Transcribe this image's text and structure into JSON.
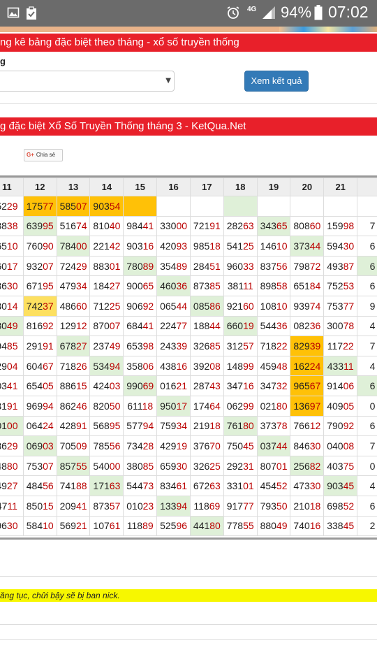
{
  "status_bar": {
    "network": "4G",
    "battery_pct": "94%",
    "time": "07:02",
    "icons": [
      "image-icon",
      "clipboard-icon",
      "alarm-icon",
      "signal-icon",
      "battery-icon"
    ]
  },
  "header_title": "ng kê bảng đặc biệt theo tháng - xổ số truyền thống",
  "form": {
    "label": "g",
    "select_value": "",
    "submit_label": "Xem kết quả"
  },
  "result_title": "g đặc biệt Xổ Số Truyền Thống tháng 3 - KetQua.Net",
  "share_label": "Chia sẻ",
  "table": {
    "columns": [
      "11",
      "12",
      "13",
      "14",
      "15",
      "16",
      "17",
      "18",
      "19",
      "20",
      "21",
      ""
    ],
    "rows": [
      [
        [
          "5229",
          ""
        ],
        [
          "17577",
          "o"
        ],
        [
          "58507",
          "o"
        ],
        [
          "90354",
          "o"
        ],
        [
          "",
          "o"
        ],
        [
          "",
          ""
        ],
        [
          "",
          ""
        ],
        [
          "",
          "g"
        ],
        [
          "",
          ""
        ],
        [
          "",
          ""
        ],
        [
          "",
          ""
        ],
        [
          "",
          ""
        ]
      ],
      [
        [
          "3838",
          ""
        ],
        [
          "63995",
          "g"
        ],
        [
          "51674",
          ""
        ],
        [
          "81040",
          ""
        ],
        [
          "98441",
          ""
        ],
        [
          "33000",
          ""
        ],
        [
          "72191",
          ""
        ],
        [
          "28263",
          ""
        ],
        [
          "34365",
          "g"
        ],
        [
          "80860",
          ""
        ],
        [
          "15998",
          ""
        ],
        [
          "7",
          ""
        ]
      ],
      [
        [
          "6510",
          ""
        ],
        [
          "76090",
          ""
        ],
        [
          "78400",
          "g"
        ],
        [
          "22142",
          ""
        ],
        [
          "90316",
          ""
        ],
        [
          "42093",
          ""
        ],
        [
          "98518",
          ""
        ],
        [
          "54125",
          ""
        ],
        [
          "14610",
          ""
        ],
        [
          "37344",
          "g"
        ],
        [
          "59430",
          ""
        ],
        [
          "6",
          ""
        ]
      ],
      [
        [
          "6017",
          ""
        ],
        [
          "93207",
          ""
        ],
        [
          "72429",
          ""
        ],
        [
          "88301",
          ""
        ],
        [
          "78089",
          "g"
        ],
        [
          "35489",
          ""
        ],
        [
          "28451",
          ""
        ],
        [
          "96033",
          ""
        ],
        [
          "83756",
          ""
        ],
        [
          "79872",
          ""
        ],
        [
          "49387",
          ""
        ],
        [
          "6",
          "g"
        ]
      ],
      [
        [
          "3630",
          ""
        ],
        [
          "67195",
          ""
        ],
        [
          "47934",
          ""
        ],
        [
          "18427",
          ""
        ],
        [
          "90065",
          ""
        ],
        [
          "46036",
          "g"
        ],
        [
          "87385",
          ""
        ],
        [
          "38111",
          ""
        ],
        [
          "89858",
          ""
        ],
        [
          "65184",
          ""
        ],
        [
          "75253",
          ""
        ],
        [
          "6",
          ""
        ]
      ],
      [
        [
          "3014",
          ""
        ],
        [
          "74237",
          "y"
        ],
        [
          "48660",
          ""
        ],
        [
          "71225",
          ""
        ],
        [
          "90692",
          ""
        ],
        [
          "06544",
          ""
        ],
        [
          "08586",
          "g"
        ],
        [
          "92160",
          ""
        ],
        [
          "10810",
          ""
        ],
        [
          "93974",
          ""
        ],
        [
          "75377",
          ""
        ],
        [
          "9",
          ""
        ]
      ],
      [
        [
          "8049",
          "g"
        ],
        [
          "81692",
          ""
        ],
        [
          "12912",
          ""
        ],
        [
          "87007",
          ""
        ],
        [
          "68441",
          ""
        ],
        [
          "22477",
          ""
        ],
        [
          "18844",
          ""
        ],
        [
          "66019",
          "g"
        ],
        [
          "54436",
          ""
        ],
        [
          "08236",
          ""
        ],
        [
          "30078",
          ""
        ],
        [
          "4",
          ""
        ]
      ],
      [
        [
          "9485",
          ""
        ],
        [
          "29191",
          ""
        ],
        [
          "67827",
          "g"
        ],
        [
          "23749",
          ""
        ],
        [
          "65398",
          ""
        ],
        [
          "24339",
          ""
        ],
        [
          "32685",
          ""
        ],
        [
          "31257",
          ""
        ],
        [
          "71822",
          ""
        ],
        [
          "82939",
          "o"
        ],
        [
          "11722",
          ""
        ],
        [
          "7",
          ""
        ]
      ],
      [
        [
          "2904",
          ""
        ],
        [
          "60467",
          ""
        ],
        [
          "71826",
          ""
        ],
        [
          "53494",
          "g"
        ],
        [
          "35806",
          ""
        ],
        [
          "43816",
          ""
        ],
        [
          "39208",
          ""
        ],
        [
          "14899",
          ""
        ],
        [
          "45948",
          ""
        ],
        [
          "16224",
          "o"
        ],
        [
          "43311",
          "g"
        ],
        [
          "4",
          ""
        ]
      ],
      [
        [
          "0341",
          ""
        ],
        [
          "65405",
          ""
        ],
        [
          "88615",
          ""
        ],
        [
          "42403",
          ""
        ],
        [
          "99069",
          "g"
        ],
        [
          "01621",
          ""
        ],
        [
          "28743",
          ""
        ],
        [
          "34716",
          ""
        ],
        [
          "34732",
          ""
        ],
        [
          "96567",
          "o"
        ],
        [
          "91406",
          ""
        ],
        [
          "6",
          "g"
        ]
      ],
      [
        [
          "3191",
          ""
        ],
        [
          "96994",
          ""
        ],
        [
          "86246",
          ""
        ],
        [
          "82050",
          ""
        ],
        [
          "61118",
          ""
        ],
        [
          "95017",
          "g"
        ],
        [
          "17464",
          ""
        ],
        [
          "06299",
          ""
        ],
        [
          "02180",
          ""
        ],
        [
          "13697",
          "o"
        ],
        [
          "40905",
          ""
        ],
        [
          "0",
          ""
        ]
      ],
      [
        [
          "0100",
          "g"
        ],
        [
          "06424",
          ""
        ],
        [
          "42891",
          ""
        ],
        [
          "56895",
          ""
        ],
        [
          "57794",
          ""
        ],
        [
          "75934",
          ""
        ],
        [
          "21918",
          ""
        ],
        [
          "76180",
          "g"
        ],
        [
          "37378",
          ""
        ],
        [
          "76612",
          ""
        ],
        [
          "79092",
          ""
        ],
        [
          "6",
          ""
        ]
      ],
      [
        [
          "8629",
          ""
        ],
        [
          "06903",
          "g"
        ],
        [
          "70509",
          ""
        ],
        [
          "78556",
          ""
        ],
        [
          "73428",
          ""
        ],
        [
          "42919",
          ""
        ],
        [
          "37670",
          ""
        ],
        [
          "75045",
          ""
        ],
        [
          "03744",
          "g"
        ],
        [
          "84630",
          ""
        ],
        [
          "04008",
          ""
        ],
        [
          "7",
          ""
        ]
      ],
      [
        [
          "4880",
          ""
        ],
        [
          "75307",
          ""
        ],
        [
          "85755",
          "g"
        ],
        [
          "54000",
          ""
        ],
        [
          "38085",
          ""
        ],
        [
          "65930",
          ""
        ],
        [
          "32625",
          ""
        ],
        [
          "29231",
          ""
        ],
        [
          "80701",
          ""
        ],
        [
          "25682",
          "g"
        ],
        [
          "40375",
          ""
        ],
        [
          "0",
          ""
        ]
      ],
      [
        [
          "4927",
          ""
        ],
        [
          "48456",
          ""
        ],
        [
          "74188",
          ""
        ],
        [
          "17163",
          "g"
        ],
        [
          "54473",
          ""
        ],
        [
          "83461",
          ""
        ],
        [
          "67263",
          ""
        ],
        [
          "33101",
          ""
        ],
        [
          "45452",
          ""
        ],
        [
          "47330",
          ""
        ],
        [
          "90345",
          "g"
        ],
        [
          "4",
          ""
        ]
      ],
      [
        [
          "4711",
          ""
        ],
        [
          "85015",
          ""
        ],
        [
          "20941",
          ""
        ],
        [
          "87357",
          ""
        ],
        [
          "01023",
          ""
        ],
        [
          "13394",
          "g"
        ],
        [
          "11869",
          ""
        ],
        [
          "91777",
          ""
        ],
        [
          "79350",
          ""
        ],
        [
          "21018",
          ""
        ],
        [
          "69852",
          ""
        ],
        [
          "6",
          ""
        ]
      ],
      [
        [
          "9630",
          ""
        ],
        [
          "58410",
          ""
        ],
        [
          "56921",
          ""
        ],
        [
          "10761",
          ""
        ],
        [
          "11889",
          ""
        ],
        [
          "52596",
          ""
        ],
        [
          "44180",
          "g"
        ],
        [
          "77855",
          ""
        ],
        [
          "88049",
          ""
        ],
        [
          "74016",
          ""
        ],
        [
          "33845",
          ""
        ],
        [
          "2",
          ""
        ]
      ]
    ]
  },
  "notice": "ăng tục, chửi bậy sẽ bị ban nick.",
  "colors": {
    "red_bar": "#e8202a",
    "button": "#337ab7",
    "highlight_orange": "#ffc107",
    "highlight_green": "#dff0d8",
    "highlight_yellow": "#fde060",
    "tail_digits": "#b00000"
  }
}
